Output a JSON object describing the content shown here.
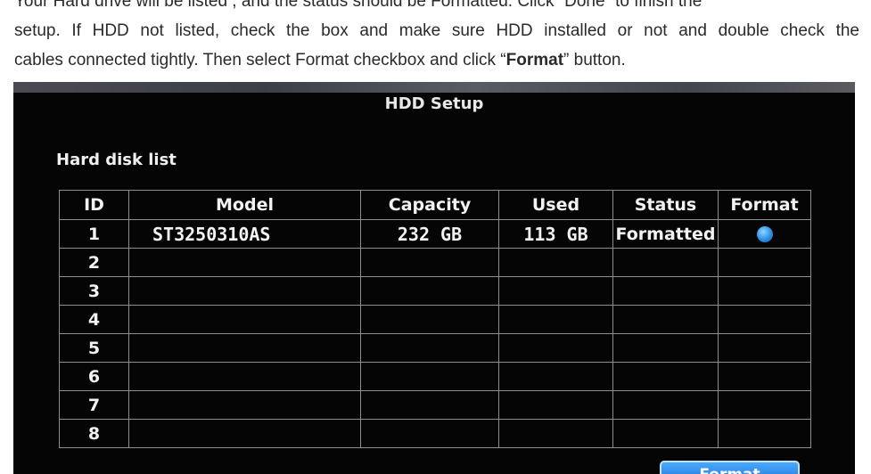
{
  "doc": {
    "line0": "Your Hard drive will be listed , and the status should be Formatted. Click “Done” to finish the",
    "line1": "setup. If HDD not listed, check the box and make sure HDD installed or not and double check the",
    "line2_prefix": "cables connected tightly. Then select Format checkbox and click “",
    "line2_bold": "Format",
    "line2_suffix": "” button."
  },
  "dialog": {
    "title": "HDD Setup",
    "section_label": "Hard disk list",
    "columns": [
      "ID",
      "Model",
      "Capacity",
      "Used",
      "Status",
      "Format"
    ],
    "rows": [
      {
        "id": "1",
        "model": "ST3250310AS",
        "capacity": "232 GB",
        "used": "113 GB",
        "status": "Formatted",
        "format_selected": true
      },
      {
        "id": "2",
        "model": "",
        "capacity": "",
        "used": "",
        "status": ""
      },
      {
        "id": "3",
        "model": "",
        "capacity": "",
        "used": "",
        "status": ""
      },
      {
        "id": "4",
        "model": "",
        "capacity": "",
        "used": "",
        "status": ""
      },
      {
        "id": "5",
        "model": "",
        "capacity": "",
        "used": "",
        "status": ""
      },
      {
        "id": "6",
        "model": "",
        "capacity": "",
        "used": "",
        "status": ""
      },
      {
        "id": "7",
        "model": "",
        "capacity": "",
        "used": "",
        "status": ""
      },
      {
        "id": "8",
        "model": "",
        "capacity": "",
        "used": "",
        "status": ""
      }
    ],
    "format_button": "Format"
  },
  "colors": {
    "dialog_bg": "#050505",
    "grid": "#8e8e8e",
    "radio_selected": "#2c8fe6",
    "button_bg": "#2a8ae8"
  }
}
